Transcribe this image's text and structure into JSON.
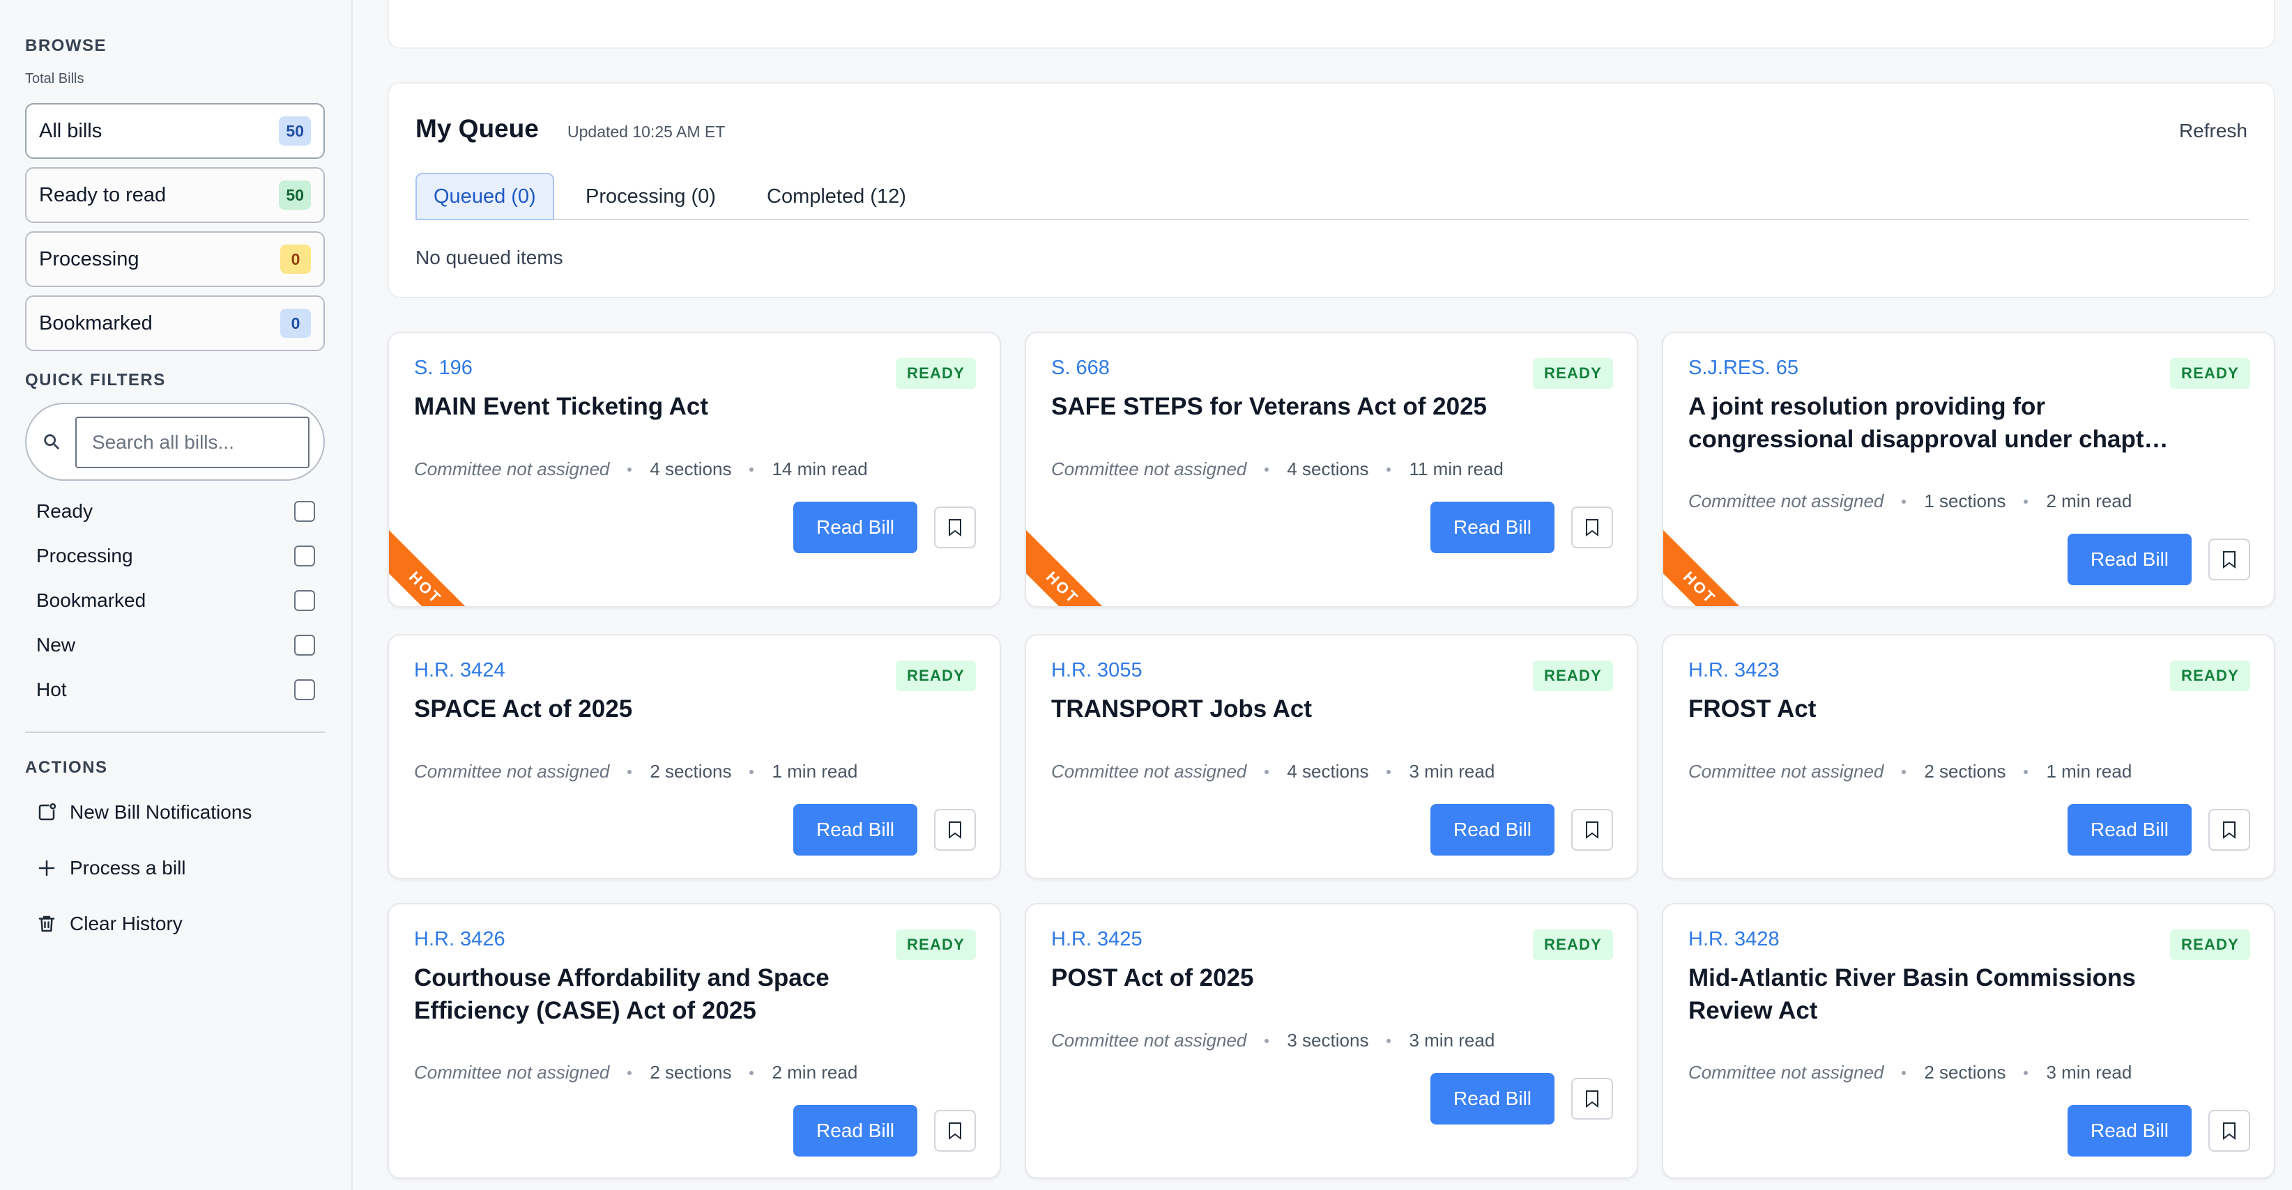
{
  "sidebar": {
    "browse_heading": "BROWSE",
    "total_label": "Total Bills",
    "browse": [
      {
        "label": "All bills",
        "count": "50",
        "color": "#cfe0fb"
      },
      {
        "label": "Ready to read",
        "count": "50",
        "color": "#c9f0d8"
      },
      {
        "label": "Processing",
        "count": "0",
        "color": "#fde68a"
      },
      {
        "label": "Bookmarked",
        "count": "0",
        "color": "#cfe0fb"
      }
    ],
    "quick_filters_heading": "QUICK FILTERS",
    "search_placeholder": "Search all bills...",
    "filters": [
      {
        "label": "Ready",
        "checked": false
      },
      {
        "label": "Processing",
        "checked": false
      },
      {
        "label": "Bookmarked",
        "checked": false
      },
      {
        "label": "New",
        "checked": false
      },
      {
        "label": "Hot",
        "checked": false
      }
    ],
    "actions_heading": "ACTIONS",
    "actions": [
      {
        "label": "New Bill Notifications",
        "icon": "notification-icon"
      },
      {
        "label": "Process a bill",
        "icon": "plus-icon"
      },
      {
        "label": "Clear History",
        "icon": "trash-icon"
      }
    ]
  },
  "queue": {
    "title": "My Queue",
    "updated": "Updated 10:25 AM ET",
    "refresh": "Refresh",
    "tabs": [
      {
        "label": "Queued (0)",
        "active": true
      },
      {
        "label": "Processing (0)",
        "active": false
      },
      {
        "label": "Completed (12)",
        "active": false
      }
    ],
    "empty": "No queued items"
  },
  "colors": {
    "accent": "#3b82f6",
    "link": "#2f7ae5",
    "ready_bg": "#dcfce7",
    "ready_text": "#15803d",
    "hot": "#f97316"
  },
  "bill_labels": {
    "status": "READY",
    "read_button": "Read Bill",
    "hot": "HOT"
  },
  "bills": [
    {
      "id": "S. 196",
      "title": "MAIN Event Ticketing Act",
      "committee": "Committee not assigned",
      "sections": "4 sections",
      "read_time": "14 min read",
      "hot": true
    },
    {
      "id": "S. 668",
      "title": "SAFE STEPS for Veterans Act of 2025",
      "committee": "Committee not assigned",
      "sections": "4 sections",
      "read_time": "11 min read",
      "hot": true
    },
    {
      "id": "S.J.RES. 65",
      "title": "A joint resolution providing for congressional disapproval under chapt…",
      "committee": "Committee not assigned",
      "sections": "1 sections",
      "read_time": "2 min read",
      "hot": true
    },
    {
      "id": "H.R. 3424",
      "title": "SPACE Act of 2025",
      "committee": "Committee not assigned",
      "sections": "2 sections",
      "read_time": "1 min read",
      "hot": false
    },
    {
      "id": "H.R. 3055",
      "title": "TRANSPORT Jobs Act",
      "committee": "Committee not assigned",
      "sections": "4 sections",
      "read_time": "3 min read",
      "hot": false
    },
    {
      "id": "H.R. 3423",
      "title": "FROST Act",
      "committee": "Committee not assigned",
      "sections": "2 sections",
      "read_time": "1 min read",
      "hot": false
    },
    {
      "id": "H.R. 3426",
      "title": "Courthouse Affordability and Space Efficiency (CASE) Act of 2025",
      "committee": "Committee not assigned",
      "sections": "2 sections",
      "read_time": "2 min read",
      "hot": false
    },
    {
      "id": "H.R. 3425",
      "title": "POST Act of 2025",
      "committee": "Committee not assigned",
      "sections": "3 sections",
      "read_time": "3 min read",
      "hot": false
    },
    {
      "id": "H.R. 3428",
      "title": "Mid-Atlantic River Basin Commissions Review Act",
      "committee": "Committee not assigned",
      "sections": "2 sections",
      "read_time": "3 min read",
      "hot": false
    }
  ]
}
